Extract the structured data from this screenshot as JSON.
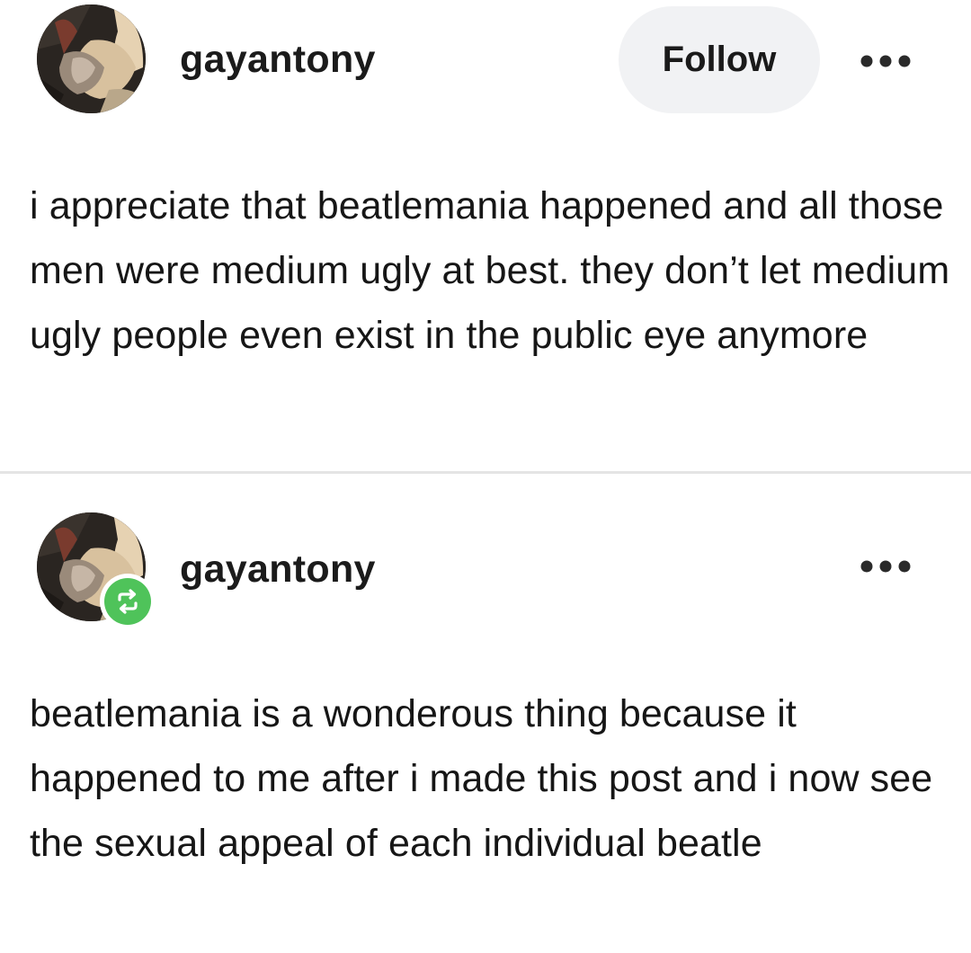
{
  "original_post": {
    "username": "gayantony",
    "follow_label": "Follow",
    "more_icon": "more-horizontal-icon",
    "body": "i appreciate that beatlemania happened and all those men were medium ugly at best. they don’t let medium ugly people even exist in the public eye anymore"
  },
  "reblog_post": {
    "username": "gayantony",
    "more_icon": "more-horizontal-icon",
    "badge_icon": "reblog-icon",
    "badge_color": "#4fc35a",
    "body": "beatlemania is a wonderous thing because it happened to me after i made this post and i now see the sexual appeal of each individual beatle"
  },
  "colors": {
    "follow_button_bg": "#f1f2f4",
    "divider": "#e4e4e4",
    "text": "#161616"
  }
}
